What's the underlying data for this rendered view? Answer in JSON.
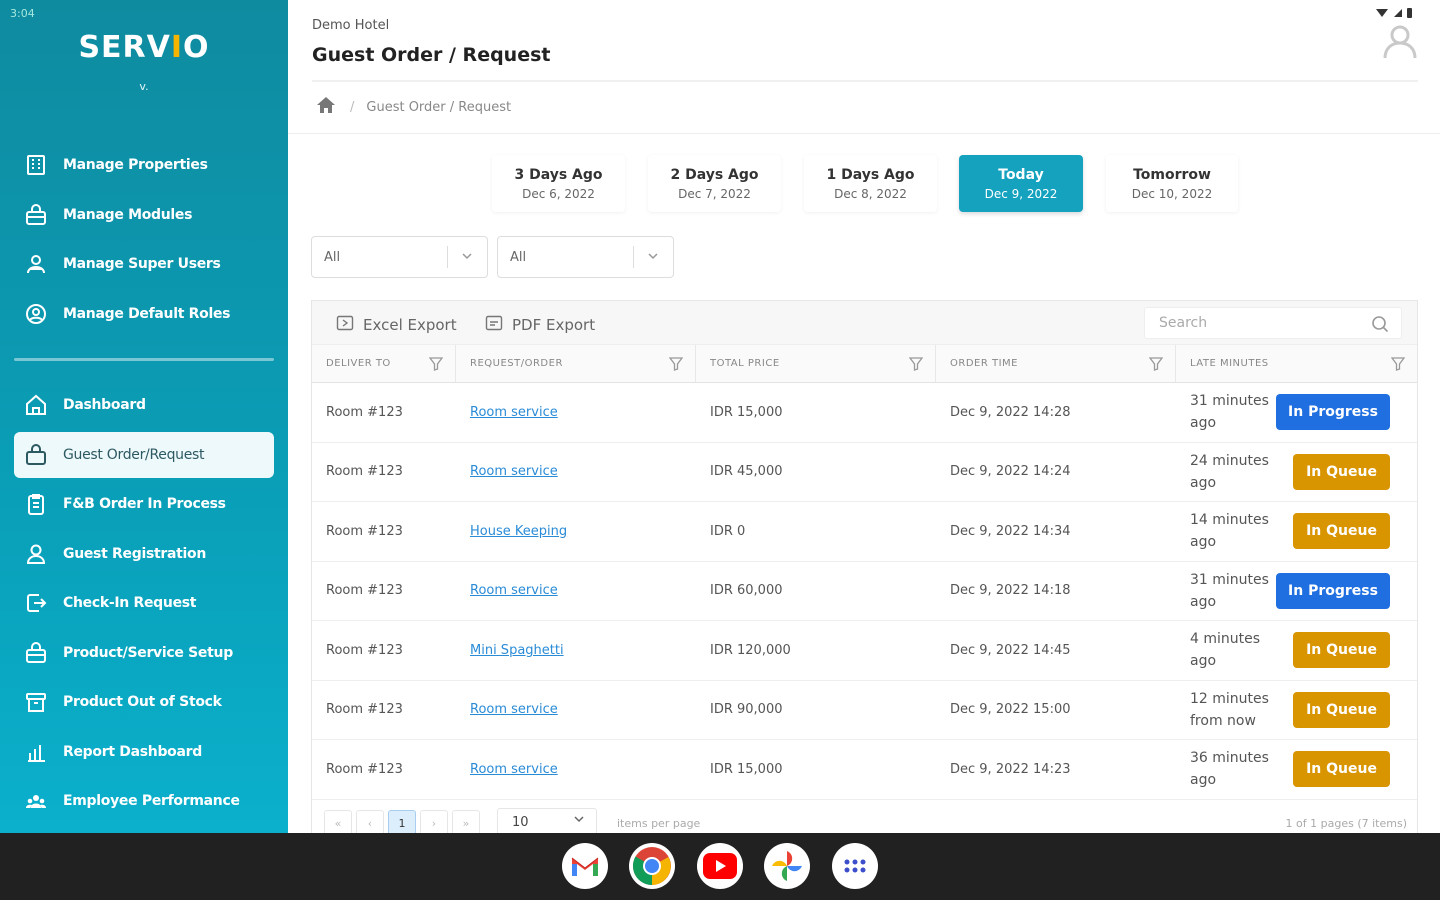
{
  "status": {
    "time": "3:04"
  },
  "app": {
    "logo_text": "SERVIO",
    "version": "v."
  },
  "header": {
    "hotel": "Demo Hotel",
    "title": "Guest Order / Request"
  },
  "breadcrumb": {
    "current": "Guest Order / Request"
  },
  "sidebar": {
    "top_items": [
      {
        "label": "Manage Properties",
        "icon": "building-icon"
      },
      {
        "label": "Manage Modules",
        "icon": "basket-icon"
      },
      {
        "label": "Manage Super Users",
        "icon": "users-icon"
      },
      {
        "label": "Manage Default Roles",
        "icon": "role-icon"
      }
    ],
    "items": [
      {
        "label": "Dashboard",
        "icon": "home-icon"
      },
      {
        "label": "Guest Order/Request",
        "icon": "basket-icon",
        "active": true
      },
      {
        "label": "F&B Order In Process",
        "icon": "clipboard-icon"
      },
      {
        "label": "Guest Registration",
        "icon": "user-icon"
      },
      {
        "label": "Check-In Request",
        "icon": "checkin-icon"
      },
      {
        "label": "Product/Service Setup",
        "icon": "basket-icon"
      },
      {
        "label": "Product Out of Stock",
        "icon": "box-icon"
      },
      {
        "label": "Report Dashboard",
        "icon": "chart-icon"
      },
      {
        "label": "Employee Performance",
        "icon": "team-icon"
      }
    ]
  },
  "date_tabs": [
    {
      "label": "3 Days Ago",
      "date": "Dec 6, 2022"
    },
    {
      "label": "2 Days Ago",
      "date": "Dec 7, 2022"
    },
    {
      "label": "1 Days Ago",
      "date": "Dec 8, 2022"
    },
    {
      "label": "Today",
      "date": "Dec 9, 2022",
      "active": true
    },
    {
      "label": "Tomorrow",
      "date": "Dec 10, 2022"
    }
  ],
  "filters": [
    {
      "value": "All"
    },
    {
      "value": "All"
    }
  ],
  "toolbar": {
    "excel_label": "Excel Export",
    "pdf_label": "PDF Export",
    "search_placeholder": "Search"
  },
  "table": {
    "columns": [
      "DELIVER TO",
      "REQUEST/ORDER",
      "TOTAL PRICE",
      "ORDER TIME",
      "LATE MINUTES"
    ],
    "rows": [
      {
        "deliver_to": "Room #123",
        "request": "Room service",
        "price": "IDR 15,000",
        "time": "Dec 9, 2022 14:28",
        "late": "31 minutes ago",
        "status": "In Progress"
      },
      {
        "deliver_to": "Room #123",
        "request": "Room service",
        "price": "IDR 45,000",
        "time": "Dec 9, 2022 14:24",
        "late": "24 minutes ago",
        "status": "In Queue"
      },
      {
        "deliver_to": "Room #123",
        "request": "House Keeping",
        "price": "IDR 0",
        "time": "Dec 9, 2022 14:34",
        "late": "14 minutes ago",
        "status": "In Queue"
      },
      {
        "deliver_to": "Room #123",
        "request": "Room service",
        "price": "IDR 60,000",
        "time": "Dec 9, 2022 14:18",
        "late": "31 minutes ago",
        "status": "In Progress"
      },
      {
        "deliver_to": "Room #123",
        "request": "Mini Spaghetti",
        "price": "IDR 120,000",
        "time": "Dec 9, 2022 14:45",
        "late": "4 minutes ago",
        "status": "In Queue"
      },
      {
        "deliver_to": "Room #123",
        "request": "Room service",
        "price": "IDR 90,000",
        "time": "Dec 9, 2022 15:00",
        "late": "12 minutes from now",
        "status": "In Queue"
      },
      {
        "deliver_to": "Room #123",
        "request": "Room service",
        "price": "IDR 15,000",
        "time": "Dec 9, 2022 14:23",
        "late": "36 minutes ago",
        "status": "In Queue"
      }
    ]
  },
  "pager": {
    "current_page": "1",
    "page_size": "10",
    "page_size_label": "items per page",
    "summary": "1 of 1 pages (7 items)"
  },
  "colors": {
    "accent": "#14a2bf",
    "in_progress": "#1f6fe0",
    "in_queue": "#d99500",
    "link": "#2a8bd6"
  },
  "taskbar": {
    "apps": [
      "gmail-icon",
      "chrome-icon",
      "youtube-icon",
      "photos-icon",
      "app-launcher-icon"
    ]
  }
}
